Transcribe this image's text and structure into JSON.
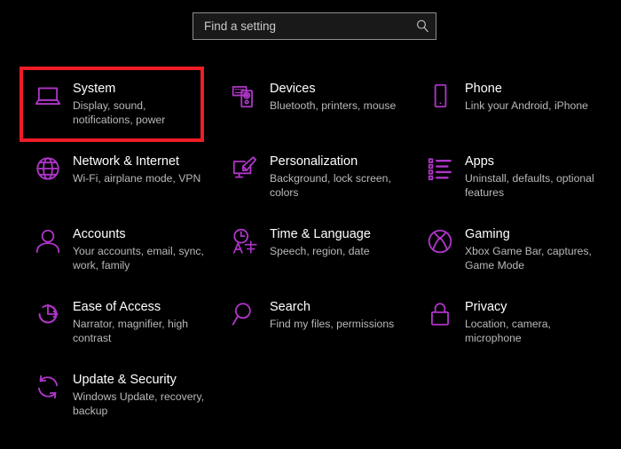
{
  "window": {
    "title": "Settings",
    "background_color": "#000000",
    "accent_color": "#b035c9",
    "highlight_color": "#ee1c25"
  },
  "search": {
    "placeholder": "Find a setting",
    "value": "",
    "icon": "search-icon"
  },
  "tiles": [
    {
      "id": "system",
      "icon": "laptop-icon",
      "title": "System",
      "subtitle": "Display, sound, notifications, power",
      "highlighted": true
    },
    {
      "id": "devices",
      "icon": "keyboard-mouse-icon",
      "title": "Devices",
      "subtitle": "Bluetooth, printers, mouse",
      "highlighted": false
    },
    {
      "id": "phone",
      "icon": "phone-icon",
      "title": "Phone",
      "subtitle": "Link your Android, iPhone",
      "highlighted": false
    },
    {
      "id": "network-internet",
      "icon": "globe-icon",
      "title": "Network & Internet",
      "subtitle": "Wi-Fi, airplane mode, VPN",
      "highlighted": false
    },
    {
      "id": "personalization",
      "icon": "monitor-brush-icon",
      "title": "Personalization",
      "subtitle": "Background, lock screen, colors",
      "highlighted": false
    },
    {
      "id": "apps",
      "icon": "list-icon",
      "title": "Apps",
      "subtitle": "Uninstall, defaults, optional features",
      "highlighted": false
    },
    {
      "id": "accounts",
      "icon": "person-icon",
      "title": "Accounts",
      "subtitle": "Your accounts, email, sync, work, family",
      "highlighted": false
    },
    {
      "id": "time-language",
      "icon": "clock-language-icon",
      "title": "Time & Language",
      "subtitle": "Speech, region, date",
      "highlighted": false
    },
    {
      "id": "gaming",
      "icon": "xbox-icon",
      "title": "Gaming",
      "subtitle": "Xbox Game Bar, captures, Game Mode",
      "highlighted": false
    },
    {
      "id": "ease-of-access",
      "icon": "accessibility-icon",
      "title": "Ease of Access",
      "subtitle": "Narrator, magnifier, high contrast",
      "highlighted": false
    },
    {
      "id": "search",
      "icon": "magnifier-icon",
      "title": "Search",
      "subtitle": "Find my files, permissions",
      "highlighted": false
    },
    {
      "id": "privacy",
      "icon": "lock-icon",
      "title": "Privacy",
      "subtitle": "Location, camera, microphone",
      "highlighted": false
    },
    {
      "id": "update-security",
      "icon": "refresh-icon",
      "title": "Update & Security",
      "subtitle": "Windows Update, recovery, backup",
      "highlighted": false
    }
  ]
}
